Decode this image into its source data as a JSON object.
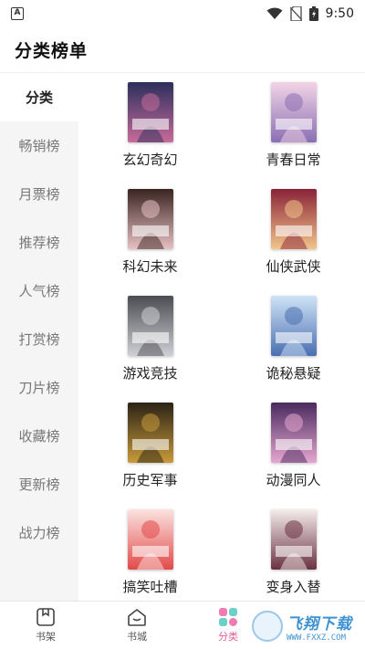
{
  "status_bar": {
    "time": "9:50",
    "app_badge_icon": "a-badge-icon"
  },
  "header": {
    "title": "分类榜单"
  },
  "sidebar": {
    "items": [
      {
        "label": "分类",
        "active": true
      },
      {
        "label": "畅销榜",
        "active": false
      },
      {
        "label": "月票榜",
        "active": false
      },
      {
        "label": "推荐榜",
        "active": false
      },
      {
        "label": "人气榜",
        "active": false
      },
      {
        "label": "打赏榜",
        "active": false
      },
      {
        "label": "刀片榜",
        "active": false
      },
      {
        "label": "收藏榜",
        "active": false
      },
      {
        "label": "更新榜",
        "active": false
      },
      {
        "label": "战力榜",
        "active": false
      }
    ]
  },
  "categories": [
    {
      "label": "玄幻奇幻",
      "cover_title": "我家女徒弟是魔王",
      "colors": [
        "#2b2f5c",
        "#c76b9a"
      ]
    },
    {
      "label": "青春日常",
      "cover_title": "我的朋友是绿茶",
      "colors": [
        "#f3d4e6",
        "#8a6fb3"
      ]
    },
    {
      "label": "科幻未来",
      "cover_title": "世界之末日",
      "colors": [
        "#3a2420",
        "#e7c1c4"
      ]
    },
    {
      "label": "仙侠武侠",
      "cover_title": "我真没想当神仙",
      "colors": [
        "#8a2338",
        "#f2c58a"
      ]
    },
    {
      "label": "游戏竞技",
      "cover_title": "最后的游戏",
      "colors": [
        "#4b4b52",
        "#cfcfd6"
      ]
    },
    {
      "label": "诡秘悬疑",
      "cover_title": "恶魔都市的一周",
      "colors": [
        "#cfe3f7",
        "#4b6fb0"
      ]
    },
    {
      "label": "历史军事",
      "cover_title": "帝国日记",
      "colors": [
        "#2a2316",
        "#c99a3a"
      ]
    },
    {
      "label": "动漫同人",
      "cover_title": "终焉之王",
      "colors": [
        "#4a2a5e",
        "#e5a7d0"
      ]
    },
    {
      "label": "搞笑吐槽",
      "cover_title": "大叔恶魔的日常",
      "colors": [
        "#fbe3e0",
        "#e24a4a"
      ]
    },
    {
      "label": "变身入替",
      "cover_title": "御姐之路",
      "colors": [
        "#f5ecec",
        "#6a3242"
      ]
    }
  ],
  "tabbar": {
    "tabs": [
      {
        "label": "书架",
        "icon": "bookshelf-icon",
        "active": false
      },
      {
        "label": "书城",
        "icon": "bookstore-icon",
        "active": false
      },
      {
        "label": "分类",
        "icon": "category-icon",
        "active": true
      }
    ]
  },
  "watermark": {
    "main": "飞翔下载",
    "sub": "WWW.FXXZ.COM"
  },
  "colors": {
    "accent": "#e35d9a",
    "sidebar_bg": "#f5f5f5",
    "watermark": "#3f93d1"
  }
}
